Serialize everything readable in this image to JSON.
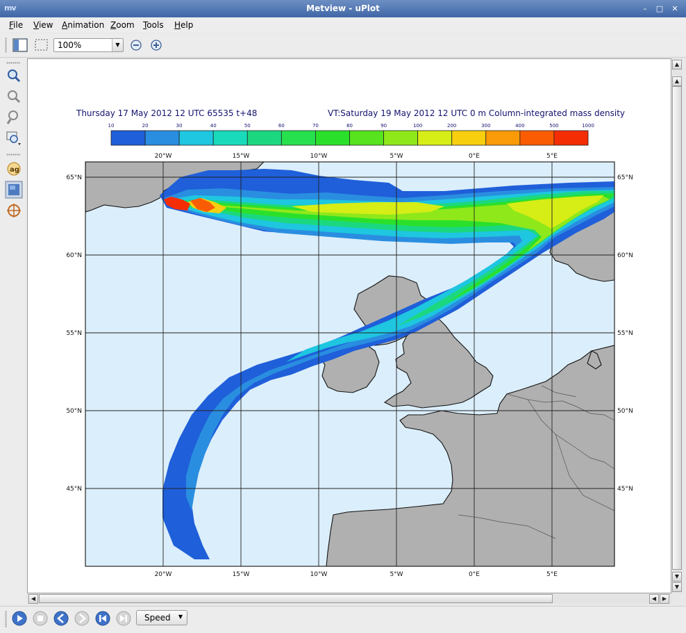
{
  "window": {
    "app_logo": "mv",
    "title": "Metview - uPlot",
    "buttons": [
      "–",
      "□",
      "✕"
    ]
  },
  "menu": {
    "items": [
      "File",
      "View",
      "Animation",
      "Zoom",
      "Tools",
      "Help"
    ]
  },
  "toolbar": {
    "zoom_value": "100%",
    "zoom_out_icon": "zoom-out-icon",
    "zoom_in_icon": "zoom-in-icon"
  },
  "plot": {
    "title_left": "Thursday 17 May 2012 12 UTC 65535 t+48",
    "title_right": "VT:Saturday 19 May 2012 12 UTC 0 m  Column-integrated mass density",
    "colorbar": {
      "levels": [
        "10",
        "20",
        "30",
        "40",
        "50",
        "60",
        "70",
        "80",
        "90",
        "100",
        "200",
        "300",
        "400",
        "500",
        "1000"
      ],
      "colors": [
        "#1f5fd9",
        "#2a8ee0",
        "#1ec6e0",
        "#19dbbb",
        "#1bd880",
        "#27e04e",
        "#2be02b",
        "#57e31e",
        "#8fe81a",
        "#d6ed16",
        "#f7cf0e",
        "#fa9a06",
        "#fa5c04",
        "#f52d05"
      ]
    },
    "map": {
      "lon_labels": [
        "20°W",
        "15°W",
        "10°W",
        "5°W",
        "0°E",
        "5°E"
      ],
      "lat_labels": [
        "65°N",
        "60°N",
        "55°N",
        "50°N",
        "45°N"
      ],
      "ocean_color": "#dbeefb",
      "land_color": "#b0b0b0"
    }
  },
  "playback": {
    "speed_label": "Speed"
  }
}
